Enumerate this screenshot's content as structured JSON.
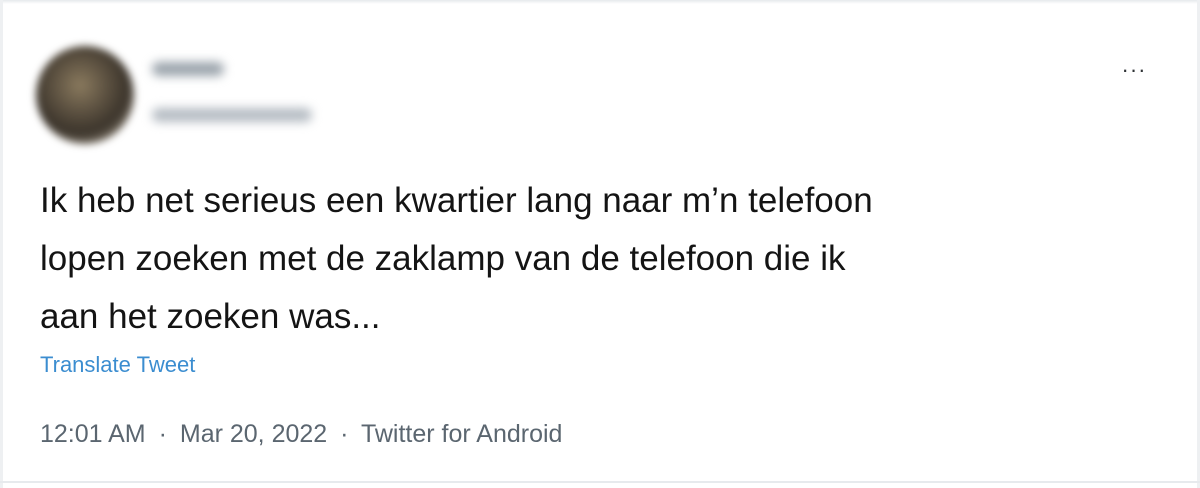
{
  "tweet": {
    "more_label": "···",
    "text_lines": [
      "Ik heb net serieus een kwartier lang naar m’n telefoon",
      "lopen zoeken met de zaklamp van de telefoon die ik",
      "aan het zoeken was..."
    ],
    "translate_label": "Translate Tweet",
    "time": "12:01 AM",
    "separator": "·",
    "date": "Mar 20, 2022",
    "source": "Twitter for Android"
  },
  "colors": {
    "link": "#3b8dd0",
    "text": "#141414",
    "meta": "#5b6670"
  },
  "icons": {
    "more": "more-horizontal-icon"
  }
}
